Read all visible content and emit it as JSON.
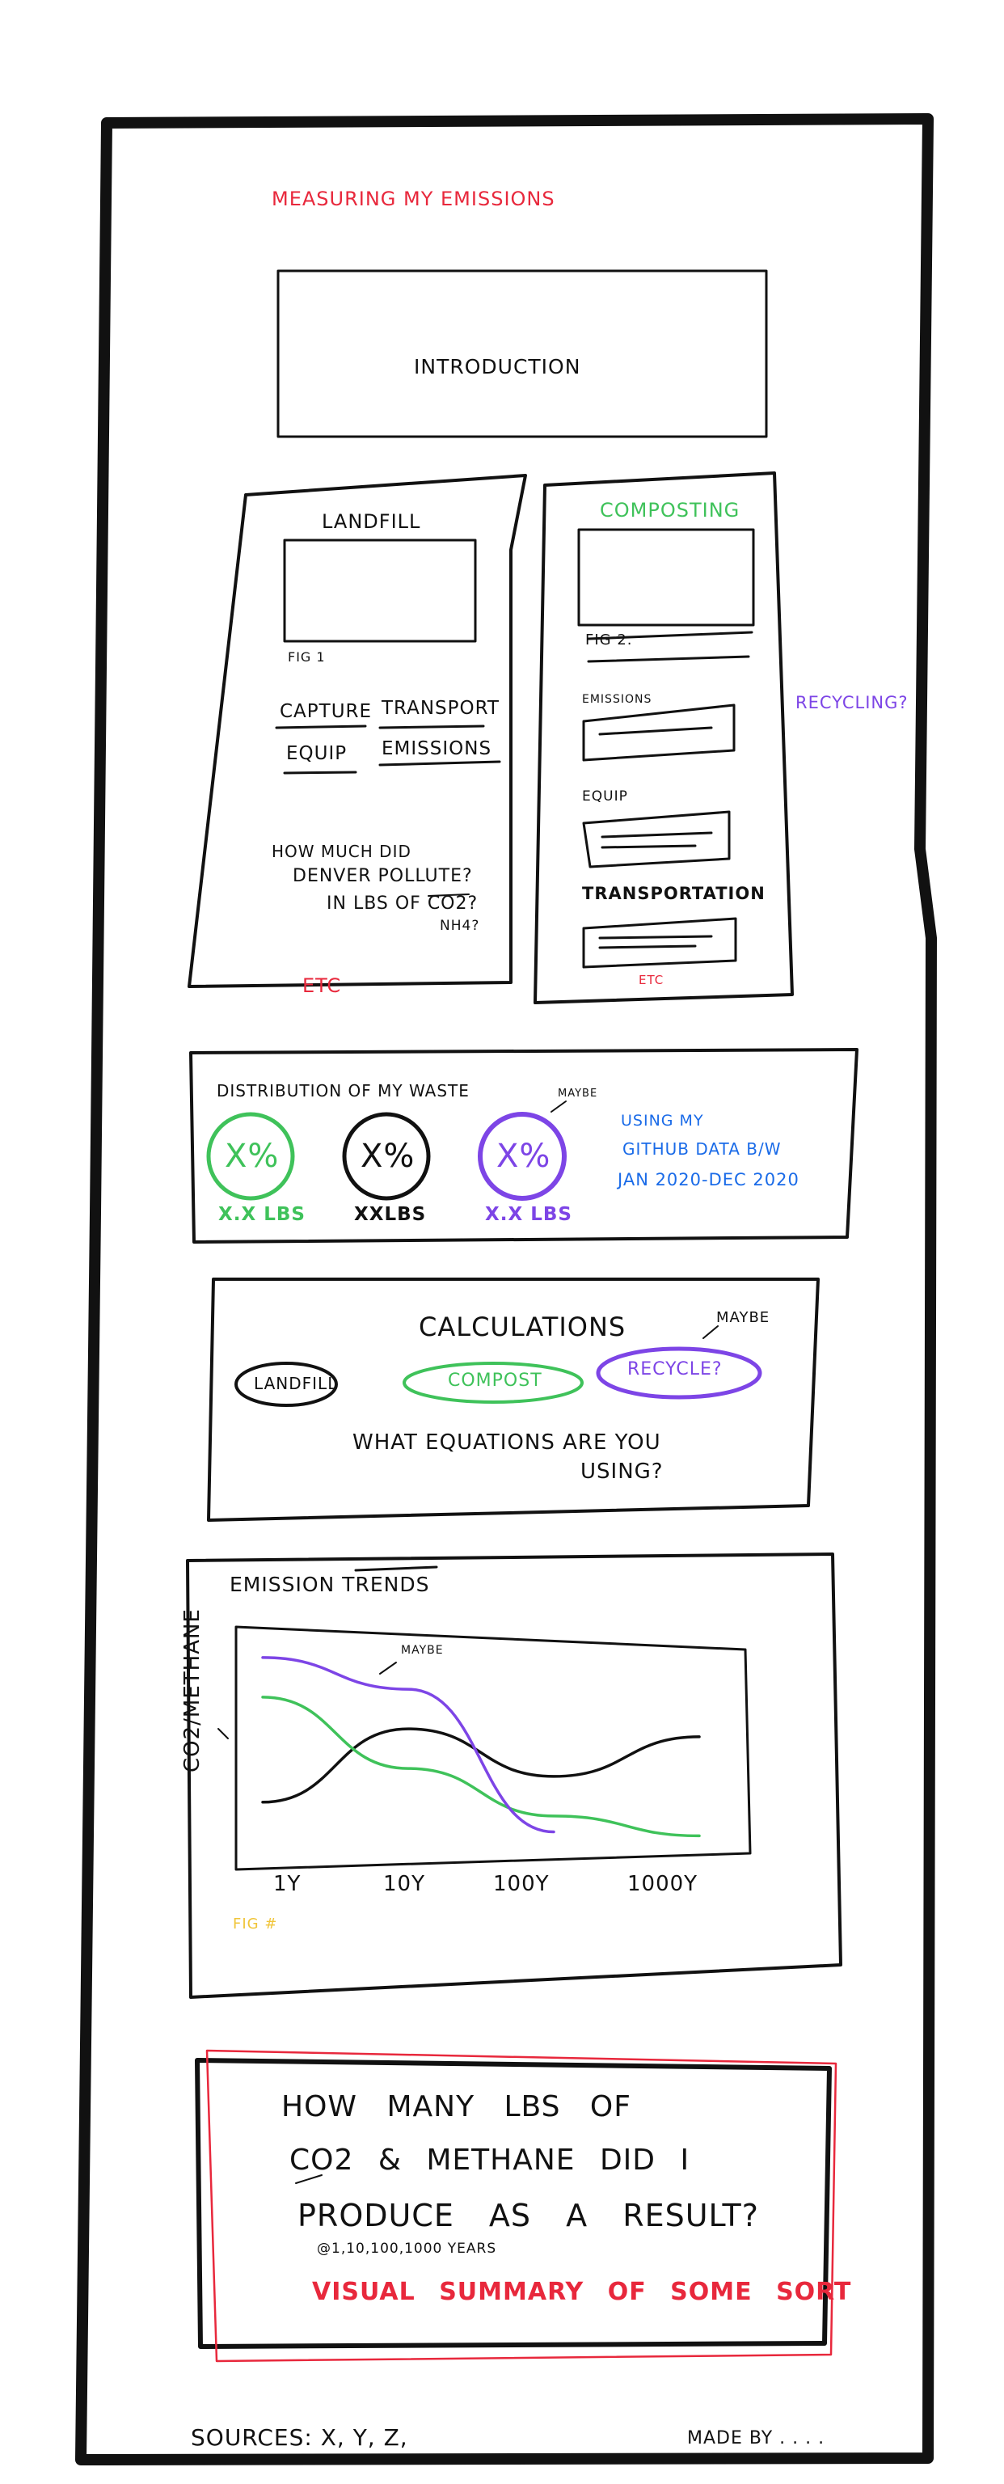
{
  "page": {
    "title": "MEASURING MY EMISSIONS",
    "intro": "INTRODUCTION"
  },
  "landfill": {
    "title": "LANDFILL",
    "fig": "FIG 1",
    "capture": "CAPTURE",
    "transport": "TRANSPORT",
    "equip": "EQUIP",
    "emissions": "EMISSIONS",
    "q1": "HOW MUCH DID",
    "q2": "DENVER POLLUTE?",
    "q3": "IN LBS OF CO2?",
    "nh": "NH4?",
    "etc": "ETC"
  },
  "composting": {
    "title": "COMPOSTING",
    "fig": "FIG 2.",
    "emissions": "EMISSIONS",
    "equip": "EQUIP",
    "transportation": "TRANSPORTATION",
    "etc": "ETC"
  },
  "side_note": "RECYCLING?",
  "distribution": {
    "title": "DISTRIBUTION OF MY WASTE",
    "maybe": "MAYBE",
    "circles": [
      {
        "pct": "X%",
        "lbs": "X.X LBS",
        "color": "#3fc25a"
      },
      {
        "pct": "X%",
        "lbs": "XXLBS",
        "color": "#111111"
      },
      {
        "pct": "X%",
        "lbs": "X.X LBS",
        "color": "#7d45e6"
      }
    ],
    "note1": "USING MY",
    "note2": "GITHUB DATA B/W",
    "note3": "JAN 2020-DEC 2020"
  },
  "calculations": {
    "title": "CALCULATIONS",
    "maybe": "MAYBE",
    "landfill": "LANDFILL",
    "compost": "COMPOST",
    "recycle": "RECYCLE?",
    "q1": "WHAT EQUATIONS ARE YOU",
    "q2": "USING?"
  },
  "trends": {
    "title": "EMISSION TRENDS",
    "ylabel": "CO2/METHANE",
    "maybe": "MAYBE",
    "fig": "FIG #"
  },
  "chart_data": {
    "type": "line",
    "x": [
      "1Y",
      "10Y",
      "100Y",
      "1000Y"
    ],
    "series": [
      {
        "values": [
          0.25,
          0.62,
          0.38,
          0.58
        ],
        "color": "#111111"
      },
      {
        "values": [
          0.78,
          0.42,
          0.18,
          0.08
        ],
        "color": "#3fc25a"
      },
      {
        "values": [
          0.98,
          0.82,
          0.1
        ],
        "color": "#7d45e6"
      }
    ],
    "ylim": [
      0,
      1
    ],
    "grid": false
  },
  "summary": {
    "q1": "HOW MANY LBS OF",
    "q2": "CO2 & METHANE DID I",
    "q3": "PRODUCE AS A RESULT?",
    "note": "@1,10,100,1000 YEARS",
    "visual": "VISUAL SUMMARY OF SOME SORT"
  },
  "footer": {
    "sources": "SOURCES: X, Y, Z,",
    "made_by": "MADE BY . . . ."
  }
}
